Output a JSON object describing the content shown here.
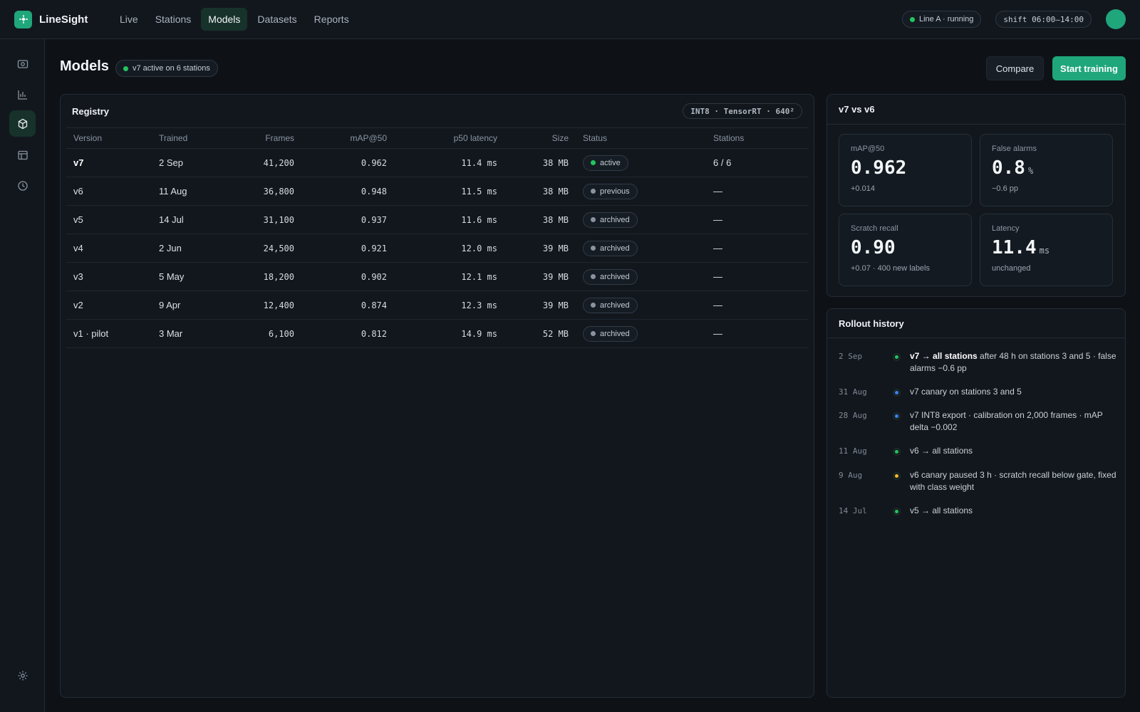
{
  "app": {
    "name": "LineSight"
  },
  "nav": [
    {
      "label": "Live"
    },
    {
      "label": "Stations"
    },
    {
      "label": "Models"
    },
    {
      "label": "Datasets"
    },
    {
      "label": "Reports"
    }
  ],
  "topbar": {
    "line_status": "Line A · running",
    "shift": "shift 06:00–14:00"
  },
  "page": {
    "title": "Models",
    "active_badge": "v7 active on 6 stations",
    "compare_label": "Compare",
    "train_label": "Start training"
  },
  "registry": {
    "title": "Registry",
    "runtime_badge": "INT8 · TensorRT · 640²",
    "columns": [
      "Version",
      "Trained",
      "Frames",
      "mAP@50",
      "p50 latency",
      "Size",
      "Status",
      "Stations"
    ],
    "rows": [
      {
        "version": "v7",
        "trained": "2 Sep",
        "frames": "41,200",
        "map": "0.962",
        "latency": "11.4 ms",
        "size": "38 MB",
        "status": "active",
        "stations": "6 / 6"
      },
      {
        "version": "v6",
        "trained": "11 Aug",
        "frames": "36,800",
        "map": "0.948",
        "latency": "11.5 ms",
        "size": "38 MB",
        "status": "previous",
        "stations": "—"
      },
      {
        "version": "v5",
        "trained": "14 Jul",
        "frames": "31,100",
        "map": "0.937",
        "latency": "11.6 ms",
        "size": "38 MB",
        "status": "archived",
        "stations": "—"
      },
      {
        "version": "v4",
        "trained": "2 Jun",
        "frames": "24,500",
        "map": "0.921",
        "latency": "12.0 ms",
        "size": "39 MB",
        "status": "archived",
        "stations": "—"
      },
      {
        "version": "v3",
        "trained": "5 May",
        "frames": "18,200",
        "map": "0.902",
        "latency": "12.1 ms",
        "size": "39 MB",
        "status": "archived",
        "stations": "—"
      },
      {
        "version": "v2",
        "trained": "9 Apr",
        "frames": "12,400",
        "map": "0.874",
        "latency": "12.3 ms",
        "size": "39 MB",
        "status": "archived",
        "stations": "—"
      },
      {
        "version": "v1 · pilot",
        "trained": "3 Mar",
        "frames": "6,100",
        "map": "0.812",
        "latency": "14.9 ms",
        "size": "52 MB",
        "status": "archived",
        "stations": "—"
      }
    ]
  },
  "compare": {
    "title": "v7 vs v6",
    "stats": [
      {
        "label": "mAP@50",
        "value": "0.962",
        "unit": "",
        "delta": "+0.014"
      },
      {
        "label": "False alarms",
        "value": "0.8",
        "unit": "%",
        "delta": "−0.6 pp"
      },
      {
        "label": "Scratch recall",
        "value": "0.90",
        "unit": "",
        "delta": "+0.07 · 400 new labels"
      },
      {
        "label": "Latency",
        "value": "11.4",
        "unit": "ms",
        "delta": "unchanged"
      }
    ]
  },
  "rollout": {
    "title": "Rollout history",
    "items": [
      {
        "date": "2 Sep",
        "bold": "v7 → all stations",
        "text": " after 48 h on stations 3 and 5 · false alarms −0.6 pp",
        "color": "#22c55e"
      },
      {
        "date": "31 Aug",
        "bold": "",
        "text": "v7 canary on stations 3 and 5",
        "color": "#3b82f6"
      },
      {
        "date": "28 Aug",
        "bold": "",
        "text": "v7 INT8 export · calibration on 2,000 frames · mAP delta −0.002",
        "color": "#3b82f6"
      },
      {
        "date": "11 Aug",
        "bold": "",
        "text": "v6 → all stations",
        "color": "#22c55e"
      },
      {
        "date": "9 Aug",
        "bold": "",
        "text": "v6 canary paused 3 h · scratch recall below gate, fixed with class weight",
        "color": "#f5b82e"
      },
      {
        "date": "14 Jul",
        "bold": "",
        "text": "v5 → all stations",
        "color": "#22c55e"
      }
    ]
  },
  "colors": {
    "accent": "#1fa67a",
    "active": "#22c55e",
    "canary": "#3b82f6",
    "warning": "#f5b82e",
    "background": "#0e1217"
  }
}
